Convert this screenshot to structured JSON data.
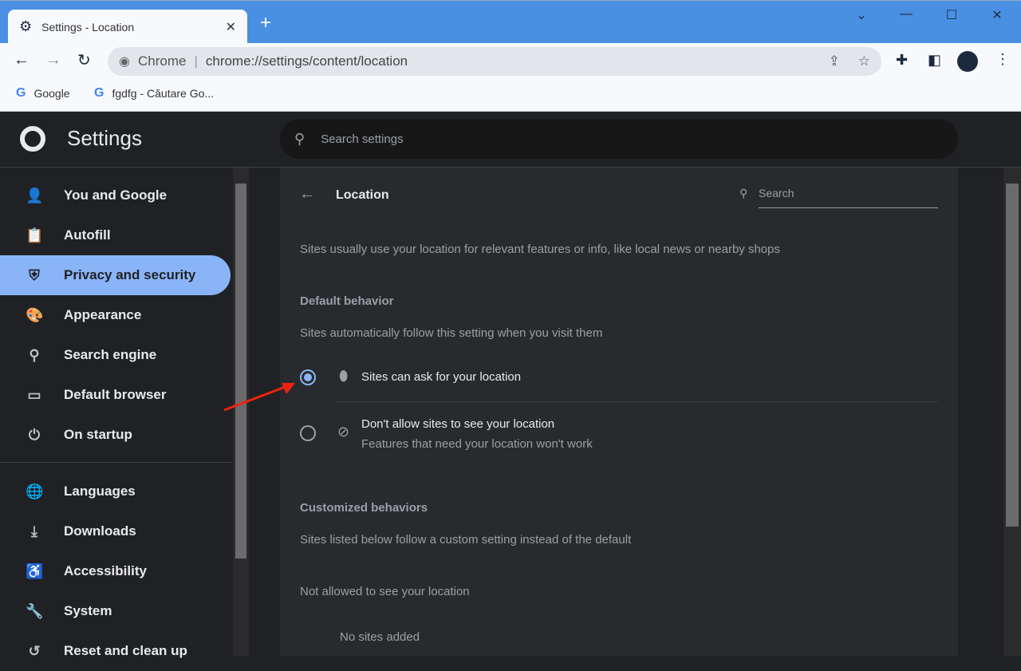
{
  "browser": {
    "tab_title": "Settings - Location",
    "omnibox_label": "Chrome",
    "url": "chrome://settings/content/location",
    "bookmarks": [
      {
        "label": "Google"
      },
      {
        "label": "fgdfg - Căutare Go..."
      }
    ]
  },
  "settings": {
    "title": "Settings",
    "search_placeholder": "Search settings"
  },
  "sidebar": {
    "items": [
      {
        "label": "You and Google",
        "icon": "person-icon"
      },
      {
        "label": "Autofill",
        "icon": "clipboard-icon"
      },
      {
        "label": "Privacy and security",
        "icon": "shield-icon",
        "active": true
      },
      {
        "label": "Appearance",
        "icon": "palette-icon"
      },
      {
        "label": "Search engine",
        "icon": "search-icon"
      },
      {
        "label": "Default browser",
        "icon": "browser-icon"
      },
      {
        "label": "On startup",
        "icon": "power-icon"
      },
      {
        "label": "Languages",
        "icon": "globe-icon"
      },
      {
        "label": "Downloads",
        "icon": "download-icon"
      },
      {
        "label": "Accessibility",
        "icon": "accessibility-icon"
      },
      {
        "label": "System",
        "icon": "wrench-icon"
      },
      {
        "label": "Reset and clean up",
        "icon": "history-icon"
      }
    ]
  },
  "page": {
    "title": "Location",
    "search_placeholder": "Search",
    "description": "Sites usually use your location for relevant features or info, like local news or nearby shops",
    "default_heading": "Default behavior",
    "default_sub": "Sites automatically follow this setting when you visit them",
    "option_ask": "Sites can ask for your location",
    "option_block": "Don't allow sites to see your location",
    "option_block_sub": "Features that need your location won't work",
    "custom_heading": "Customized behaviors",
    "custom_sub": "Sites listed below follow a custom setting instead of the default",
    "not_allowed": "Not allowed to see your location",
    "no_sites": "No sites added"
  }
}
